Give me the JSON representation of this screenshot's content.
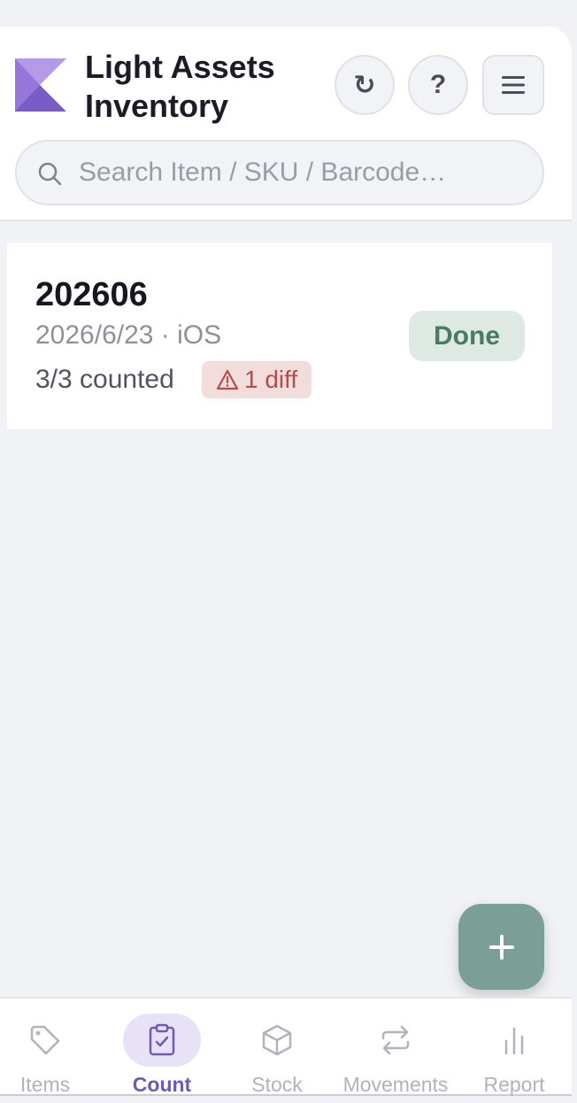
{
  "header": {
    "app_title": "Light Assets Inventory",
    "refresh_glyph": "↻",
    "help_glyph": "?",
    "search_placeholder": "Search Item / SKU / Barcode…"
  },
  "count_sessions": [
    {
      "title": "202606",
      "meta": "2026/6/23 · iOS",
      "counted": "3/3 counted",
      "diff_label": "1 diff",
      "status": "Done"
    }
  ],
  "fab": {
    "icon": "plus-icon"
  },
  "bottom_nav": [
    {
      "label": "Items",
      "icon": "tag-icon",
      "active": false
    },
    {
      "label": "Count",
      "icon": "clipboard-check-icon",
      "active": true
    },
    {
      "label": "Stock",
      "icon": "box-icon",
      "active": false
    },
    {
      "label": "Movements",
      "icon": "swap-arrows-icon",
      "active": false
    },
    {
      "label": "Report",
      "icon": "bar-chart-icon",
      "active": false
    }
  ],
  "colors": {
    "brand_purple": "#7a5cc7",
    "done_bg": "#dfe9e4",
    "done_text": "#4a7a65",
    "diff_bg": "#f3dcdc",
    "diff_text": "#b34d4d",
    "fab": "#7b9e97",
    "nav_active": "#6c5bb0"
  }
}
